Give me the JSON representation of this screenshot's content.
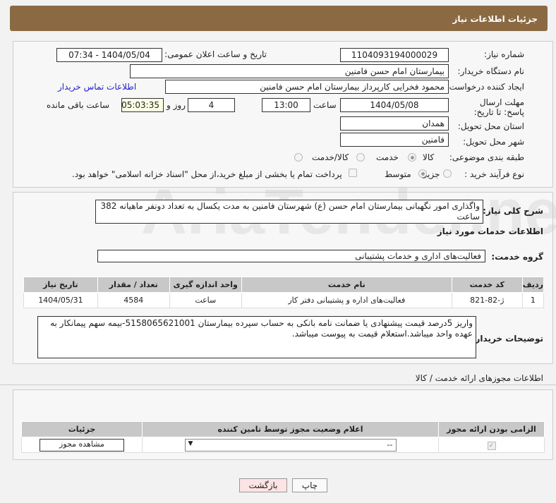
{
  "header": {
    "title": "جزئیات اطلاعات نیاز"
  },
  "fields": {
    "need_number_label": "شماره نیاز:",
    "need_number": "1104093194000029",
    "announce_label": "تاریخ و ساعت اعلان عمومی:",
    "announce_value": "1404/05/04 - 07:34",
    "buyer_org_label": "نام دستگاه خریدار:",
    "buyer_org": "بیمارستان امام حسن فامنین",
    "creator_label": "ایجاد کننده درخواست:",
    "creator": "محمود فخرایی کارپرداز بیمارستان امام حسن فامنین",
    "contact_link": "اطلاعات تماس خریدار",
    "deadline_label": "مهلت ارسال پاسخ: تا تاریخ:",
    "deadline_date": "1404/05/08",
    "time_label": "ساعت",
    "deadline_time": "13:00",
    "days": "4",
    "days_label": "روز و",
    "remaining": "05:03:35",
    "remaining_label": "ساعت باقی مانده",
    "province_label": "استان محل تحویل:",
    "province": "همدان",
    "city_label": "شهر محل تحویل:",
    "city": "فامنین",
    "category_label": "طبقه بندی موضوعی:",
    "cat_options": [
      "کالا",
      "خدمت",
      "کالا/خدمت"
    ],
    "process_label": "نوع فرآیند خرید :",
    "process_options": [
      "جزیی",
      "متوسط"
    ],
    "payment_note": "پرداخت تمام یا بخشی از مبلغ خرید،از محل \"اسناد خزانه اسلامی\" خواهد بود."
  },
  "description": {
    "label": "شرح کلی نیاز:",
    "text": "واگذاری امور نگهبانی بیمارستان امام حسن (ع) شهرستان فامنین به مدت یکسال به تعداد دونفر ماهیانه 382 ساعت"
  },
  "services": {
    "title": "اطلاعات خدمات مورد نیاز",
    "group_label": "گروه خدمت:",
    "group": "فعالیت‌های اداری و خدمات پشتیبانی",
    "headers": [
      "ردیف",
      "کد خدمت",
      "نام خدمت",
      "واحد اندازه گیری",
      "تعداد / مقدار",
      "تاریخ نیاز"
    ],
    "rows": [
      [
        "1",
        "ژ-82-821",
        "فعالیت‌های اداره و پشتیبانی دفتر کار",
        "ساعت",
        "4584",
        "1404/05/31"
      ]
    ]
  },
  "buyer_notes": {
    "label": "توضیحات خریدار:",
    "text": "واریز 5درصد قیمت پیشنهادی یا ضمانت نامه بانکی به حساب سپرده بیمارستان 5158065621001-بیمه سهم پیمانکار به عهده واحد میباشد.استعلام قیمت به پیوست میباشد."
  },
  "permits": {
    "title": "اطلاعات مجوزهای ارائه خدمت / کالا",
    "headers": [
      "الزامی بودن ارائه مجوز",
      "اعلام وضعیت مجوز توسط تامین کننده",
      "جزئیات"
    ],
    "select_value": "--",
    "view_button": "مشاهده مجوز"
  },
  "footer": {
    "print": "چاپ",
    "back": "بازگشت"
  }
}
